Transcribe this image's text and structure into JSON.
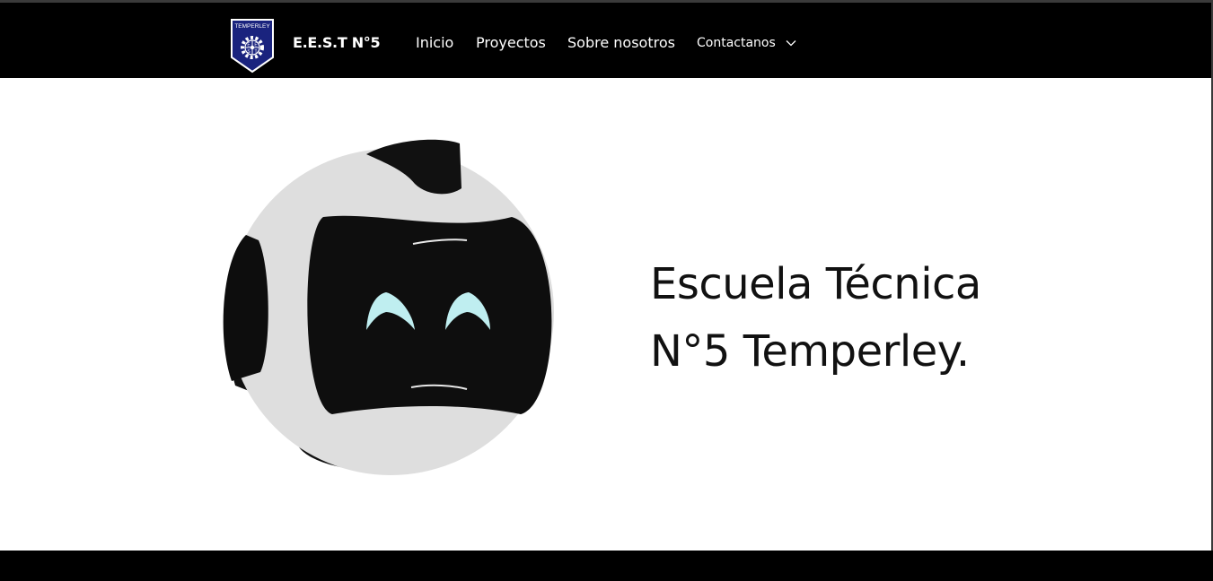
{
  "navbar": {
    "logo_text": "TEMPERLEY",
    "brand_name": "E.E.S.T N°5",
    "links": [
      {
        "label": "Inicio"
      },
      {
        "label": "Proyectos"
      },
      {
        "label": "Sobre nosotros"
      }
    ],
    "dropdown": {
      "label": "Contactanos",
      "icon": "chevron-down-icon"
    }
  },
  "hero": {
    "image": "robot-head-image",
    "title_line1": "Escuela Técnica",
    "title_line2": "N°5 Temperley."
  },
  "colors": {
    "navbar_bg": "#000000",
    "page_bg": "#ffffff",
    "robot_eye": "#bfeef0",
    "logo_blue": "#1a237e"
  }
}
